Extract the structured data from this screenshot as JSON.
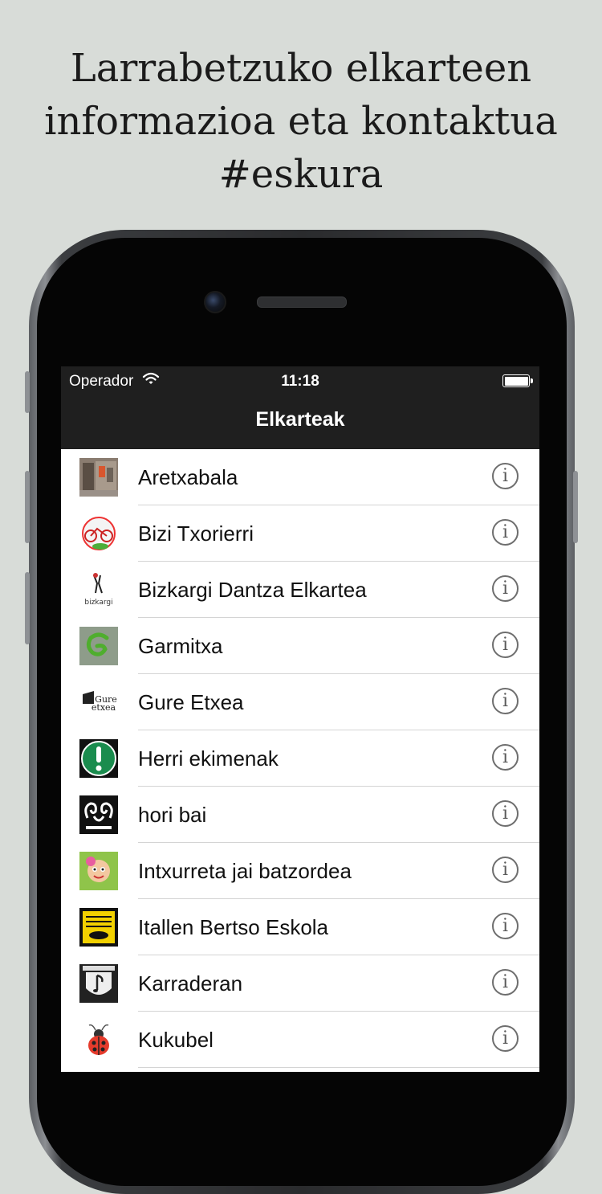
{
  "promo": {
    "line1": "Larrabetzuko elkarteen",
    "line2": "informazioa eta kontaktua",
    "line3": "#eskura"
  },
  "status_bar": {
    "carrier": "Operador",
    "time": "11:18",
    "battery_level": 1.0
  },
  "nav": {
    "title": "Elkarteak"
  },
  "items": [
    {
      "name": "Aretxabala",
      "thumb_icon": "aretxabala-photo"
    },
    {
      "name": "Bizi Txorierri",
      "thumb_icon": "bizi-txorierri-logo"
    },
    {
      "name": "Bizkargi Dantza Elkartea",
      "thumb_icon": "bizkargi-logo"
    },
    {
      "name": "Garmitxa",
      "thumb_icon": "garmitxa-logo"
    },
    {
      "name": "Gure Etxea",
      "thumb_icon": "gure-etxea-logo"
    },
    {
      "name": "Herri ekimenak",
      "thumb_icon": "herri-ekimenak-logo"
    },
    {
      "name": "hori bai",
      "thumb_icon": "hori-bai-logo"
    },
    {
      "name": "Intxurreta jai batzordea",
      "thumb_icon": "intxurreta-logo"
    },
    {
      "name": "Itallen Bertso Eskola",
      "thumb_icon": "itallen-logo"
    },
    {
      "name": "Karraderan",
      "thumb_icon": "karraderan-logo"
    },
    {
      "name": "Kukubel",
      "thumb_icon": "kukubel-logo"
    },
    {
      "name": "",
      "thumb_icon": ""
    }
  ],
  "colors": {
    "background": "#d8dcd8",
    "navbar": "#1f1f1f",
    "info_icon": "#6e6e6e"
  }
}
